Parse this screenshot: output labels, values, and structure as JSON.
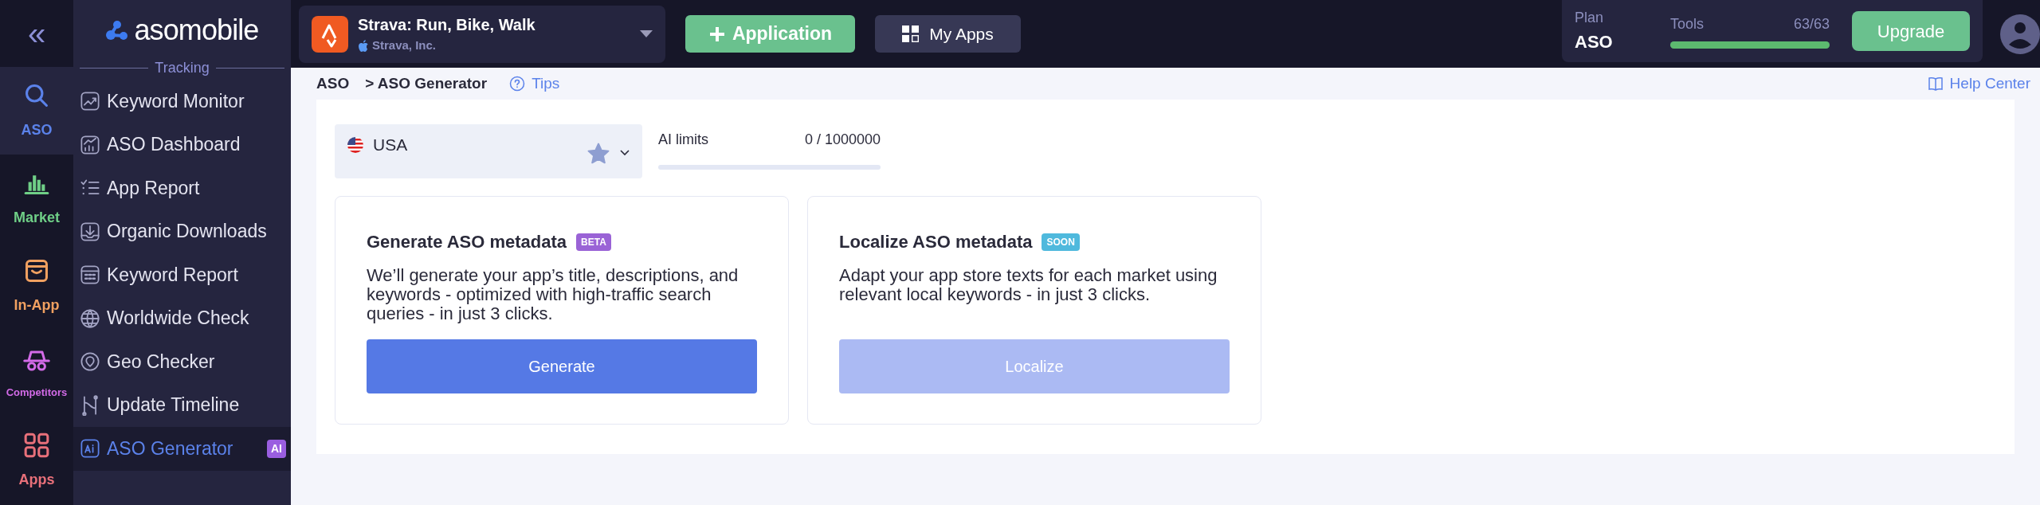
{
  "rail": {
    "collapse": "«",
    "items": [
      {
        "label": "ASO",
        "color": "#5b82ea",
        "selected": true
      },
      {
        "label": "Market",
        "color": "#6fcf87",
        "selected": false
      },
      {
        "label": "In-App",
        "color": "#f0a060",
        "selected": false
      },
      {
        "label": "Competitors",
        "color": "#d36be8",
        "selected": false
      },
      {
        "label": "Apps",
        "color": "#e8707a",
        "selected": false
      }
    ]
  },
  "sidebar": {
    "logo": "asomobile",
    "section": "Tracking",
    "items": [
      {
        "label": "Keyword Monitor",
        "selected": false
      },
      {
        "label": "ASO Dashboard",
        "selected": false
      },
      {
        "label": "App Report",
        "selected": false
      },
      {
        "label": "Organic Downloads",
        "selected": false
      },
      {
        "label": "Keyword Report",
        "selected": false
      },
      {
        "label": "Worldwide Check",
        "selected": false
      },
      {
        "label": "Geo Checker",
        "selected": false
      },
      {
        "label": "Update Timeline",
        "selected": false
      },
      {
        "label": "ASO Generator",
        "selected": true,
        "badge": "AI"
      }
    ]
  },
  "topbar": {
    "app": {
      "name": "Strava: Run, Bike, Walk",
      "developer": "Strava, Inc."
    },
    "add_button": "Application",
    "apps_button": "My Apps",
    "plan": {
      "label": "Plan",
      "name": "ASO",
      "tools_label": "Tools",
      "tools_count": "63/63",
      "level": 1
    },
    "upgrade_button": "Upgrade"
  },
  "breadcrumb": [
    "ASO",
    "> ASO Generator"
  ],
  "tips": "Tips",
  "help": "Help Center",
  "country": {
    "value": "USA",
    "favorite": true
  },
  "ai_limits": {
    "label": "AI limits",
    "reading": "0 / 1000000",
    "level": 0
  },
  "cards": [
    {
      "title": "Generate ASO metadata",
      "badge": "BETA",
      "color": "#9a63d6",
      "text": "We’ll generate your app’s title, descriptions, and keywords - optimized with high-traffic search queries - in just 3 clicks.",
      "button": "Generate",
      "disabled": false
    },
    {
      "title": "Localize ASO metadata",
      "badge": "SOON",
      "color": "#4fb9dd",
      "text": "Adapt your app store texts for each market using relevant local keywords - in just 3 clicks.",
      "button": "Localize",
      "disabled": true
    }
  ]
}
